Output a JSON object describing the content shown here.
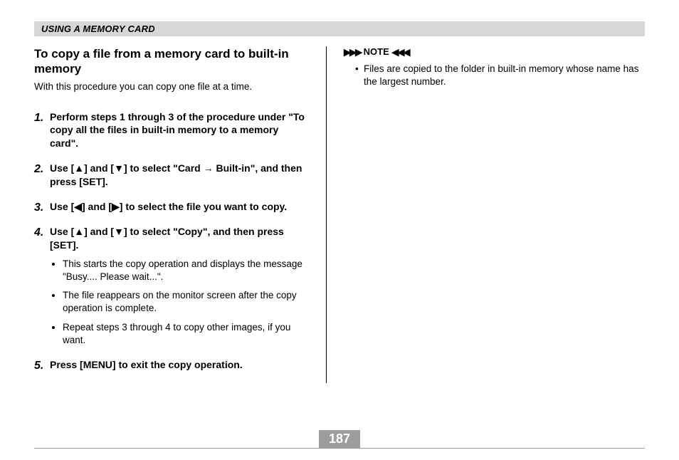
{
  "header": "USING A MEMORY CARD",
  "section_title": "To copy a file from a memory card to built-in memory",
  "intro": "With this procedure you can copy one file at a time.",
  "steps": [
    {
      "text": "Perform steps 1 through 3 of the procedure under \"To copy all the files in built-in memory to a memory card\"."
    },
    {
      "text": "Use [▲] and [▼] to select \"Card → Built-in\", and then press [SET]."
    },
    {
      "text": "Use [◀] and [▶] to select the file you want to copy."
    },
    {
      "text": "Use [▲] and [▼] to select \"Copy\", and then press [SET].",
      "subs": [
        "This starts the copy operation and displays the message \"Busy.... Please wait...\".",
        "The file reappears on the monitor screen after the copy operation is complete.",
        "Repeat steps 3 through 4 to copy other images, if you want."
      ]
    },
    {
      "text": "Press [MENU] to exit the copy operation."
    }
  ],
  "note": {
    "label": "NOTE",
    "decor_left": "▶▶▶",
    "decor_right": "◀◀◀",
    "items": [
      "Files are copied to the folder in built-in memory whose name has the largest number."
    ]
  },
  "page_number": "187"
}
